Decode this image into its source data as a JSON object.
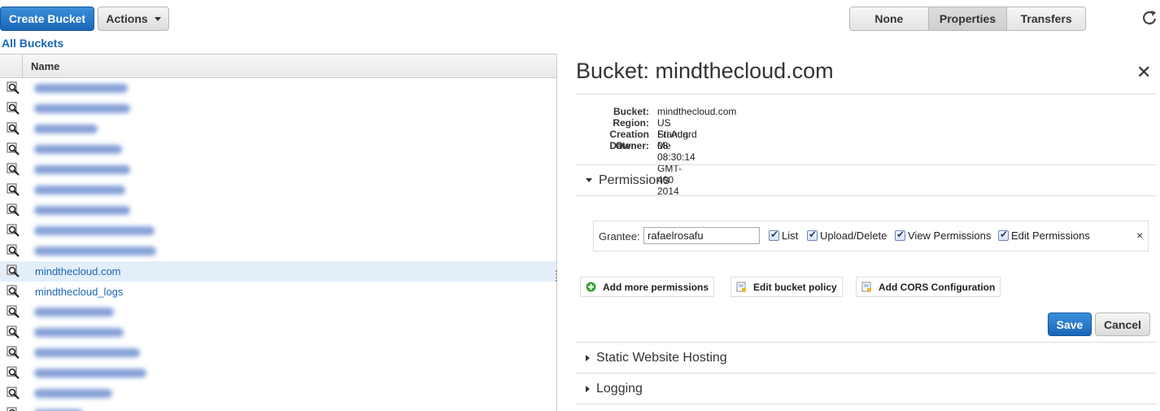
{
  "toolbar": {
    "create_bucket": "Create Bucket",
    "actions": "Actions",
    "view_tabs": [
      "None",
      "Properties",
      "Transfers"
    ],
    "active_tab": "Properties"
  },
  "breadcrumb": "All Buckets",
  "list": {
    "header": "Name",
    "visible_rows": [
      {
        "name": "",
        "redacted": true
      },
      {
        "name": "",
        "redacted": true
      },
      {
        "name": "",
        "redacted": true
      },
      {
        "name": "",
        "redacted": true
      },
      {
        "name": "",
        "redacted": true
      },
      {
        "name": "",
        "redacted": true
      },
      {
        "name": "",
        "redacted": true
      },
      {
        "name": "",
        "redacted": true
      },
      {
        "name": "",
        "redacted": true
      },
      {
        "name": "mindthecloud.com",
        "selected": true
      },
      {
        "name": "mindthecloud_logs"
      },
      {
        "name": "",
        "redacted": true
      },
      {
        "name": "",
        "redacted": true
      },
      {
        "name": "",
        "redacted": true
      },
      {
        "name": "",
        "redacted": true
      },
      {
        "name": "",
        "redacted": true
      },
      {
        "name": "",
        "redacted": true
      }
    ]
  },
  "details": {
    "title": "Bucket: mindthecloud.com",
    "fields": [
      {
        "key": "Bucket:",
        "value": "mindthecloud.com"
      },
      {
        "key": "Region:",
        "value": "US Standard"
      },
      {
        "key": "Creation Date:",
        "value": "Fri Aug 08 08:30:14 GMT-400 2014"
      },
      {
        "key": "Owner:",
        "value": "Me"
      }
    ],
    "permissions": {
      "section_label": "Permissions",
      "grantee_label": "Grantee:",
      "grantee_value": "rafaelrosafu",
      "checkboxes": [
        "List",
        "Upload/Delete",
        "View Permissions",
        "Edit Permissions"
      ],
      "remove": "×",
      "add_more": "Add more permissions",
      "edit_policy": "Edit bucket policy",
      "add_cors": "Add CORS Configuration",
      "save": "Save",
      "cancel": "Cancel"
    },
    "sections": [
      "Static Website Hosting",
      "Logging"
    ],
    "close": "✕"
  },
  "colors": {
    "primary_blue": "#1a66b8",
    "selected_row": "#e3eef9"
  }
}
